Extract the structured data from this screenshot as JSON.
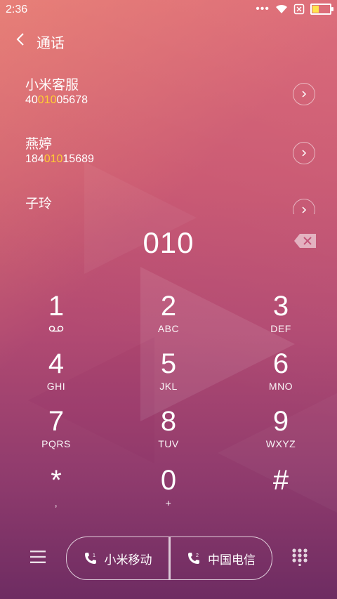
{
  "status_bar": {
    "time": "2:36",
    "dots": "•••",
    "battery_level_percent": 40,
    "battery_color": "#ffe44d"
  },
  "header": {
    "title": "通话"
  },
  "contacts": [
    {
      "name": "小米客服",
      "number_prefix": "40",
      "number_match": "010",
      "number_suffix": "05678"
    },
    {
      "name": "燕婷",
      "number_prefix": "184",
      "number_match": "010",
      "number_suffix": "15689"
    },
    {
      "name": "子玲",
      "number_prefix": "",
      "number_match": "",
      "number_suffix": ""
    }
  ],
  "highlight_color": "#ffcc33",
  "dialed": {
    "digits": "010"
  },
  "keypad": [
    {
      "digit": "1",
      "letters": ""
    },
    {
      "digit": "2",
      "letters": "ABC"
    },
    {
      "digit": "3",
      "letters": "DEF"
    },
    {
      "digit": "4",
      "letters": "GHI"
    },
    {
      "digit": "5",
      "letters": "JKL"
    },
    {
      "digit": "6",
      "letters": "MNO"
    },
    {
      "digit": "7",
      "letters": "PQRS"
    },
    {
      "digit": "8",
      "letters": "TUV"
    },
    {
      "digit": "9",
      "letters": "WXYZ"
    },
    {
      "digit": "*",
      "letters": ","
    },
    {
      "digit": "0",
      "letters": "+"
    },
    {
      "digit": "#",
      "letters": ""
    }
  ],
  "bottom": {
    "sim1_label": "小米移动",
    "sim2_label": "中国电信",
    "sim2_badge": "2"
  },
  "icons": [
    "wifi-icon",
    "no-sim-icon",
    "battery-icon",
    "back-icon",
    "chevron-right-icon",
    "delete-icon",
    "voicemail-icon",
    "menu-icon",
    "phone-icon",
    "dialpad-icon"
  ]
}
